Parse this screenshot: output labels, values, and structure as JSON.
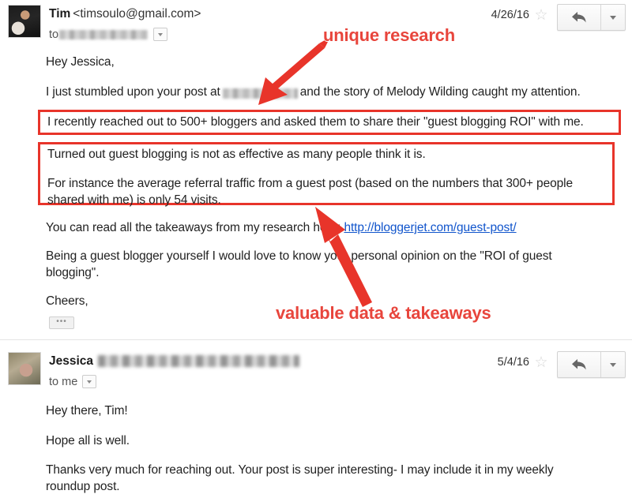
{
  "messages": [
    {
      "sender_name": "Tim",
      "sender_email": "<timsoulo@gmail.com>",
      "to_label": "to",
      "date": "4/26/16",
      "star_glyph": "☆",
      "paragraphs": {
        "greeting": "Hey Jessica,",
        "intro_before": "I just stumbled upon your post at",
        "intro_after": "and the story of Melody Wilding caught my attention.",
        "highlight_one": "I recently reached out to 500+ bloggers and asked them to share their \"guest blogging ROI\" with me.",
        "highlight_two_a": "Turned out guest blogging is not as effective as many people think it is.",
        "highlight_two_b": "For instance the average referral traffic from a guest post (based on the numbers that 300+ people shared with me) is only 54 visits.",
        "takeaways_before": "You can read all the takeaways from my research here:",
        "takeaways_link": "http://bloggerjet.com/guest-post/",
        "opinion": "Being a guest blogger yourself I would love to know your personal opinion on the \"ROI of guest blogging\".",
        "signoff": "Cheers,"
      },
      "trimmed_button": "•••"
    },
    {
      "sender_name": "Jessica",
      "to_label": "to me",
      "date": "5/4/16",
      "star_glyph": "☆",
      "paragraphs": {
        "greeting": "Hey there, Tim!",
        "line_two": "Hope all is well.",
        "line_three": "Thanks very much for reaching out. Your post is super interesting- I may include it in my weekly roundup post."
      }
    }
  ],
  "annotations": [
    {
      "label": "unique research"
    },
    {
      "label": "valuable data & takeaways"
    }
  ],
  "colors": {
    "annotation_red": "#e8453c",
    "highlight_border": "#e8342a",
    "link_blue": "#1155cc",
    "arrow_red": "#e8342a"
  }
}
